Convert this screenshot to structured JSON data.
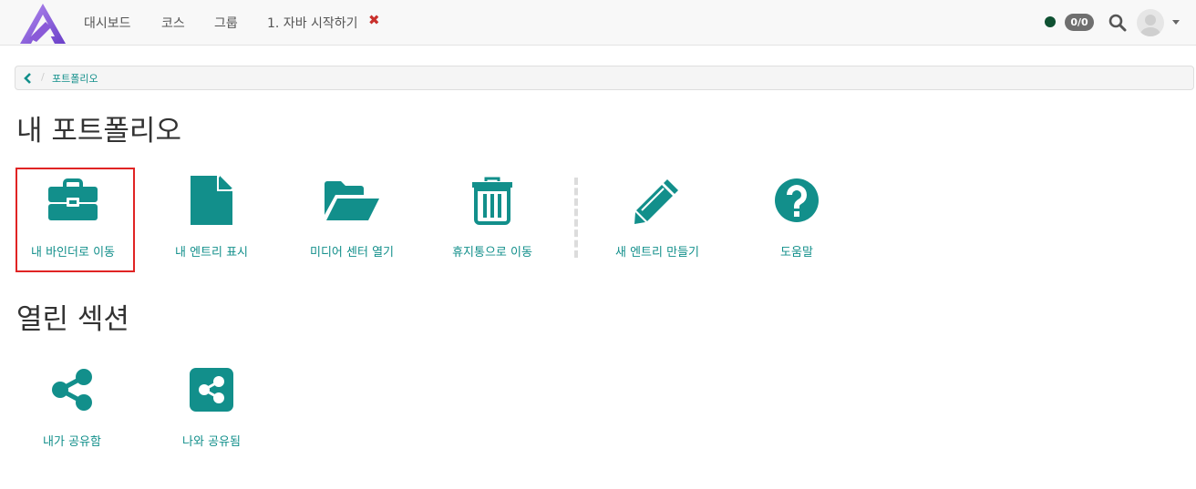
{
  "nav": {
    "items": [
      {
        "label": "대시보드"
      },
      {
        "label": "코스"
      },
      {
        "label": "그룹"
      },
      {
        "label": "1. 자바 시작하기"
      }
    ],
    "close_label": "✖",
    "score": "0/0",
    "status_color": "#0f5132"
  },
  "breadcrumb": {
    "separator": "/",
    "current": "포트폴리오"
  },
  "portfolio": {
    "title": "내 포트폴리오",
    "tiles": [
      {
        "label": "내 바인더로 이동",
        "icon": "briefcase-icon"
      },
      {
        "label": "내 엔트리 표시",
        "icon": "file-icon"
      },
      {
        "label": "미디어 센터 열기",
        "icon": "folder-open-icon"
      },
      {
        "label": "휴지통으로 이동",
        "icon": "trash-icon"
      },
      {
        "label": "새 엔트리 만들기",
        "icon": "pencil-icon"
      },
      {
        "label": "도움말",
        "icon": "question-circle-icon"
      }
    ]
  },
  "shared": {
    "title": "열린 섹션",
    "tiles": [
      {
        "label": "내가 공유함",
        "icon": "share-icon"
      },
      {
        "label": "나와 공유됨",
        "icon": "share-square-icon"
      }
    ]
  },
  "colors": {
    "accent": "#128f8b",
    "highlight": "#e02424"
  }
}
